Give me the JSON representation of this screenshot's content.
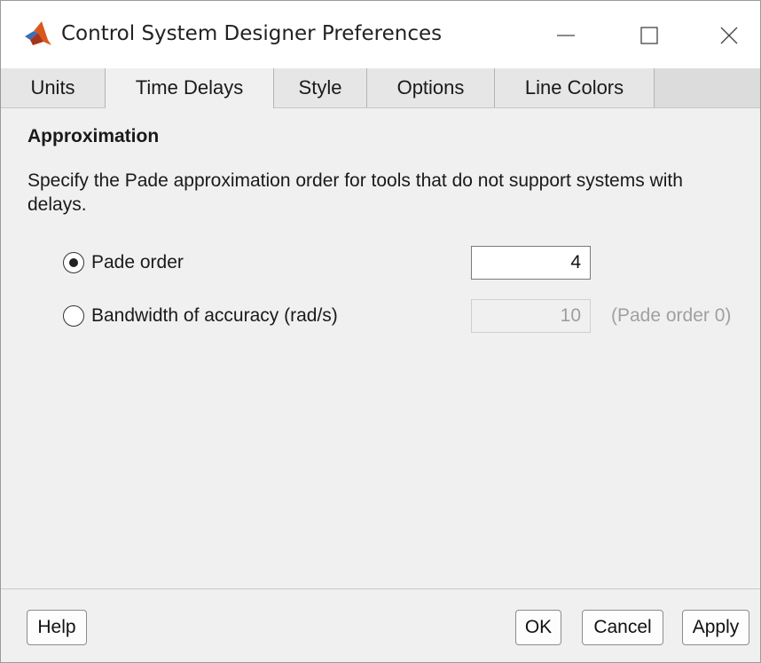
{
  "window": {
    "title": "Control System Designer Preferences",
    "controls": {
      "minimize": "minimize-icon",
      "maximize": "maximize-icon",
      "close": "close-icon"
    }
  },
  "tabs": [
    {
      "label": "Units",
      "active": false
    },
    {
      "label": "Time Delays",
      "active": true
    },
    {
      "label": "Style",
      "active": false
    },
    {
      "label": "Options",
      "active": false
    },
    {
      "label": "Line Colors",
      "active": false
    }
  ],
  "content": {
    "section_title": "Approximation",
    "description": "Specify the Pade approximation order for tools that do not support systems with delays.",
    "options": [
      {
        "label": "Pade order",
        "selected": true,
        "value": "4",
        "enabled": true
      },
      {
        "label": "Bandwidth of accuracy (rad/s)",
        "selected": false,
        "value": "10",
        "enabled": false,
        "hint": "(Pade order 0)"
      }
    ]
  },
  "buttons": {
    "help": "Help",
    "ok": "OK",
    "cancel": "Cancel",
    "apply": "Apply"
  },
  "colors": {
    "window_bg": "#f0f0f0",
    "tab_strip": "#dcdcdc",
    "matlab_icon": "#c44a1b"
  }
}
